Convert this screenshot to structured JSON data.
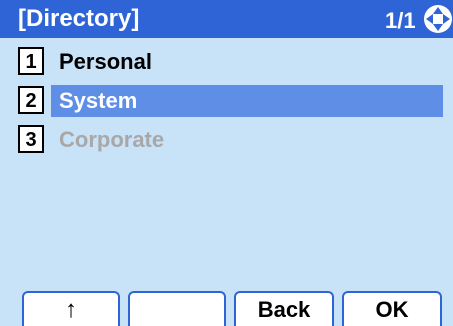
{
  "header": {
    "title": "[Directory]",
    "page_indicator": "1/1",
    "nav_icon": "four-way-navigation-icon"
  },
  "menu": {
    "items": [
      {
        "number": "1",
        "label": "Personal",
        "state": "normal"
      },
      {
        "number": "2",
        "label": "System",
        "state": "selected"
      },
      {
        "number": "3",
        "label": "Corporate",
        "state": "disabled"
      }
    ]
  },
  "softkeys": [
    {
      "label": "↑",
      "icon": "up-arrow-icon"
    },
    {
      "label": ""
    },
    {
      "label": "Back"
    },
    {
      "label": "OK"
    }
  ],
  "colors": {
    "header_bg": "#2e64d6",
    "screen_bg": "#c8e2f8",
    "selected_bg": "#5f8ee6",
    "disabled_text": "#a8a8a8"
  }
}
